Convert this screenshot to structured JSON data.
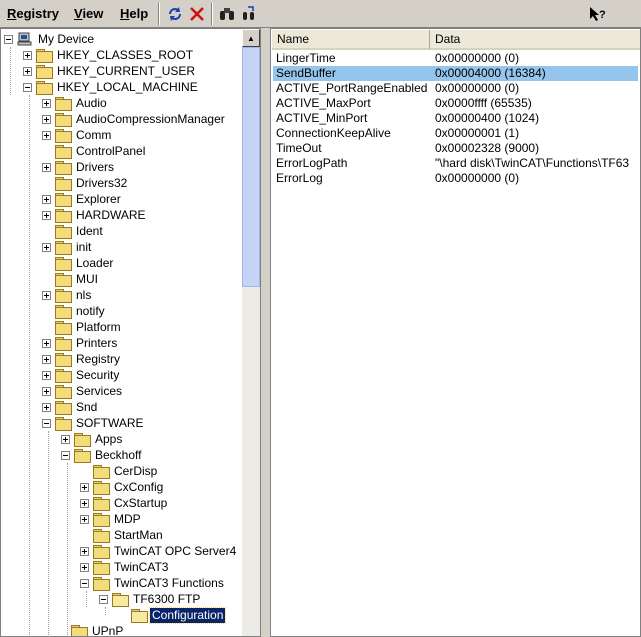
{
  "menu": {
    "registry": {
      "underline": "R",
      "rest": "egistry"
    },
    "view": {
      "underline": "V",
      "rest": "iew"
    },
    "help": {
      "underline": "H",
      "rest": "elp"
    }
  },
  "toolbar": {
    "icons": [
      "refresh-icon",
      "delete-icon",
      "find-icon",
      "find-next-icon",
      "context-help-icon"
    ]
  },
  "tree": {
    "root": "My Device",
    "hives": [
      "HKEY_CLASSES_ROOT",
      "HKEY_CURRENT_USER",
      "HKEY_LOCAL_MACHINE"
    ],
    "hklm_children": [
      "Audio",
      "AudioCompressionManager",
      "Comm",
      "ControlPanel",
      "Drivers",
      "Drivers32",
      "Explorer",
      "HARDWARE",
      "Ident",
      "init",
      "Loader",
      "MUI",
      "nls",
      "notify",
      "Platform",
      "Printers",
      "Registry",
      "Security",
      "Services",
      "Snd",
      "SOFTWARE"
    ],
    "software_children": [
      "Apps",
      "Beckhoff"
    ],
    "beckhoff_children": [
      "CerDisp",
      "CxConfig",
      "CxStartup",
      "MDP",
      "StartMan",
      "TwinCAT OPC Server4",
      "TwinCAT3",
      "TwinCAT3 Functions"
    ],
    "functions_child": "TF6300 FTP",
    "selected": "Configuration",
    "after": "UPnP"
  },
  "list": {
    "headers": {
      "name": "Name",
      "data": "Data"
    },
    "rows": [
      {
        "name": "LingerTime",
        "data": "0x00000000 (0)"
      },
      {
        "name": "SendBuffer",
        "data": "0x00004000 (16384)"
      },
      {
        "name": "ACTIVE_PortRangeEnabled",
        "data": "0x00000000 (0)"
      },
      {
        "name": "ACTIVE_MaxPort",
        "data": "0x0000ffff (65535)"
      },
      {
        "name": "ACTIVE_MinPort",
        "data": "0x00000400 (1024)"
      },
      {
        "name": "ConnectionKeepAlive",
        "data": "0x00000001 (1)"
      },
      {
        "name": "TimeOut",
        "data": "0x00002328 (9000)"
      },
      {
        "name": "ErrorLogPath",
        "data": "\"\\hard disk\\TwinCAT\\Functions\\TF63"
      },
      {
        "name": "ErrorLog",
        "data": "0x00000000 (0)"
      }
    ],
    "selected_index": 1
  },
  "colors": {
    "selection": "#0a246a",
    "list_selection": "#95c5ec",
    "window": "#d4d0c8"
  }
}
